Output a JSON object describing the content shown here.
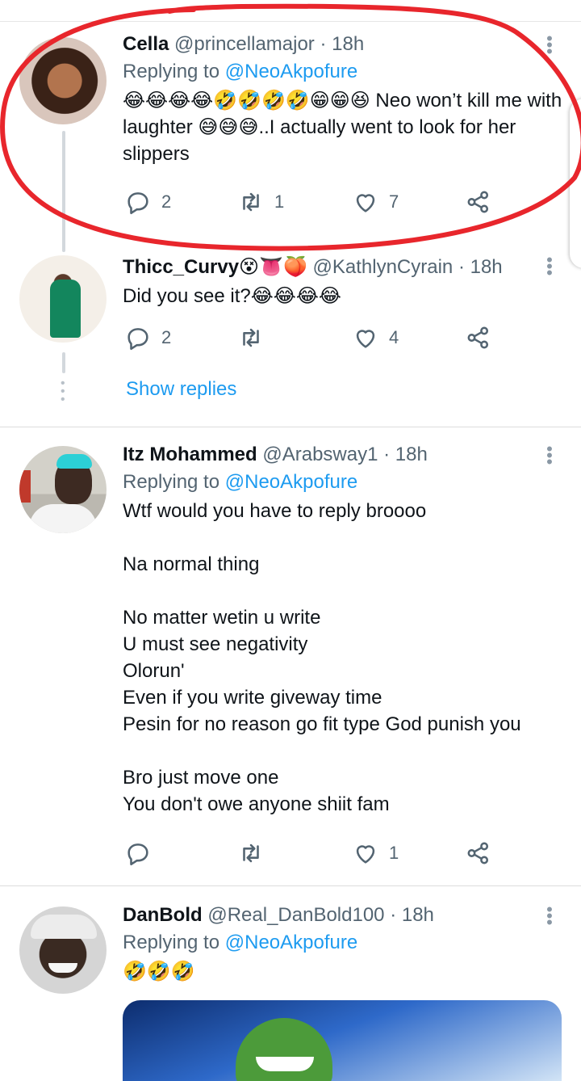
{
  "colors": {
    "accent": "#1d9bf0",
    "secondary_text": "#536471",
    "annotation": "#e8262c"
  },
  "tweets": [
    {
      "name": "Cella",
      "handle": "@princellamajor",
      "time": "· 18h",
      "reply_prefix": "Replying to",
      "reply_handle": "@NeoAkpofure",
      "text": "😂😂😂😂🤣🤣🤣🤣😁😁😆 Neo won’t kill me with laughter 😅😅😅..I actually went to look for her slippers",
      "replies": "2",
      "retweets": "1",
      "likes": "7"
    },
    {
      "name": "Thicc_Curvy😵👅🍑",
      "handle": "@KathlynCyrain",
      "time": "· 18h",
      "text": "Did you see it?😂😂😂😂",
      "replies": "2",
      "retweets": "",
      "likes": "4",
      "show_replies": "Show replies"
    },
    {
      "name": "Itz Mohammed",
      "handle": "@Arabsway1",
      "time": "· 18h",
      "reply_prefix": "Replying to",
      "reply_handle": "@NeoAkpofure",
      "text": "Wtf would you have to reply broooo\n\nNa normal thing\n\nNo matter wetin u write\nU must see negativity\nOlorun'\nEven if you write giveway time\nPesin for no reason go fit type God punish you\n\nBro just move one\nYou don't owe anyone shiit fam",
      "replies": "",
      "retweets": "",
      "likes": "1"
    },
    {
      "name": "DanBold",
      "handle": "@Real_DanBold100",
      "time": "· 18h",
      "reply_prefix": "Replying to",
      "reply_handle": "@NeoAkpofure",
      "text": "🤣🤣🤣"
    }
  ]
}
